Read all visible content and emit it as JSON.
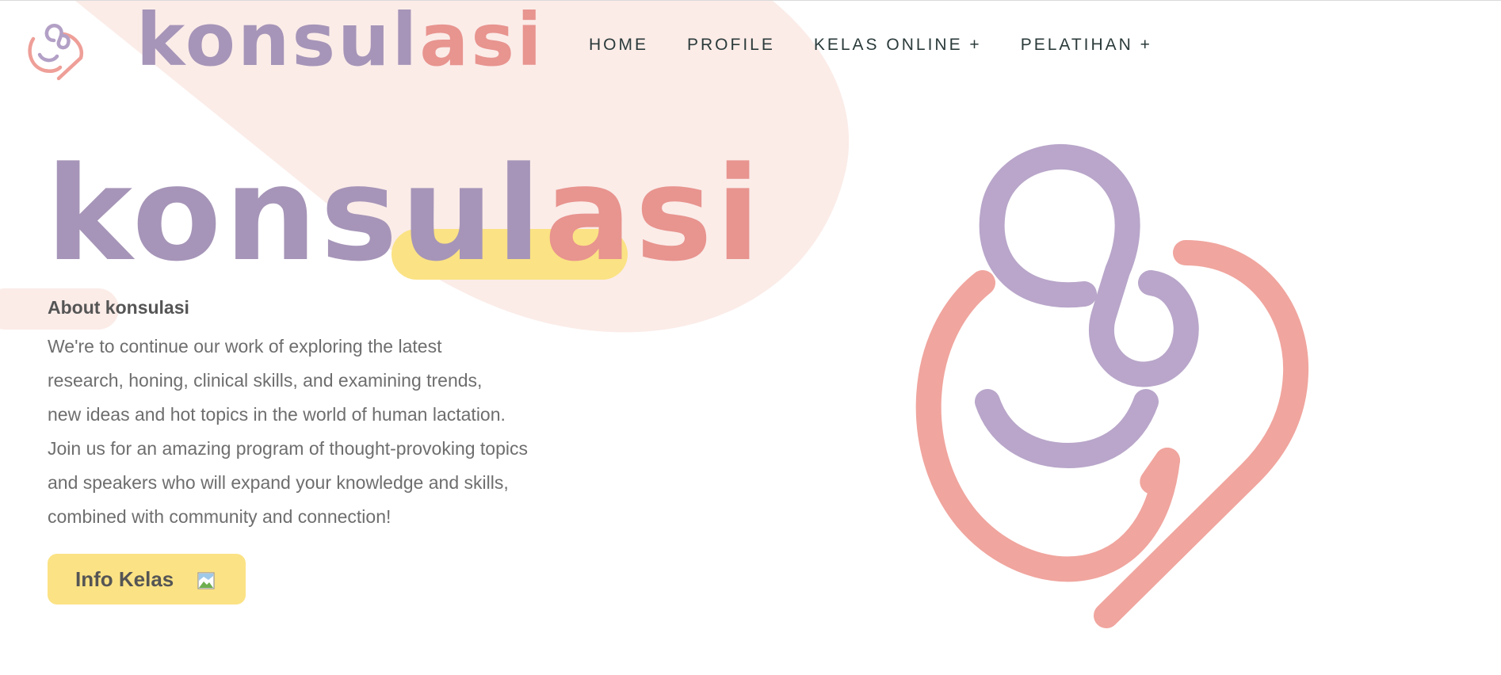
{
  "brand": {
    "part1": "konsul",
    "part2": "asi",
    "colors": {
      "purple": "#a695b8",
      "pink": "#e8948f",
      "yellow": "#fbe284",
      "blush": "#fbece8"
    }
  },
  "nav": {
    "items": [
      {
        "label": "HOME"
      },
      {
        "label": "PROFILE"
      },
      {
        "label": "KELAS ONLINE +"
      },
      {
        "label": "PELATIHAN +"
      }
    ]
  },
  "hero": {
    "title_part1": "konsul",
    "title_part2": "asi",
    "about_title": "About konsulasi",
    "about_lines": [
      "We're to continue our work of exploring the latest",
      "research, honing, clinical skills, and examining trends,",
      "new ideas and hot topics in the world of human lactation.",
      "Join us for an amazing program of thought-provoking topics",
      "and speakers who will expand your knowledge and skills,",
      "combined with community and connection!"
    ],
    "cta_label": "Info Kelas",
    "cta_icon": "broken-image-icon"
  },
  "icons": {
    "header_logo": "konsulasi-logo-icon",
    "hero_logo": "konsulasi-logo-illustration"
  }
}
